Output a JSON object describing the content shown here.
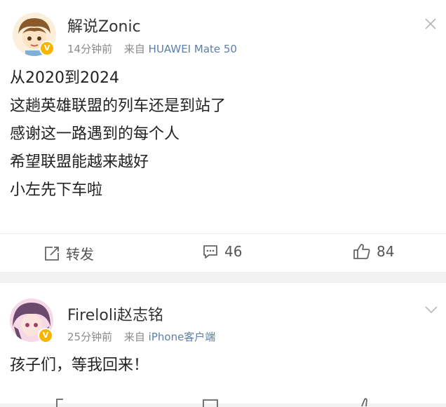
{
  "post": {
    "author": "解说Zonic",
    "time": "14分钟前",
    "source_prefix": "来自",
    "source": "HUAWEI Mate 50",
    "lines": [
      "从2020到2024",
      "这趟英雄联盟的列车还是到站了",
      "感谢这一路遇到的每个人",
      "希望联盟能越来越好",
      "小左先下车啦"
    ],
    "actions": {
      "repost_label": "转发",
      "comments": "46",
      "likes": "84"
    }
  },
  "comment": {
    "author": "Fireloli赵志铭",
    "time": "25分钟前",
    "source_prefix": "来自",
    "source": "iPhone客户端",
    "text": "孩子们，等我回来！"
  },
  "icons": {
    "close": "close-icon",
    "chevron": "chevron-down-icon",
    "repost": "repost-icon",
    "comment": "comment-icon",
    "like": "like-icon",
    "verified": "verified-badge"
  },
  "colors": {
    "accent_badge": "#f7b500",
    "link": "#5b7fa8",
    "meta_gray": "#8a8a8a"
  }
}
